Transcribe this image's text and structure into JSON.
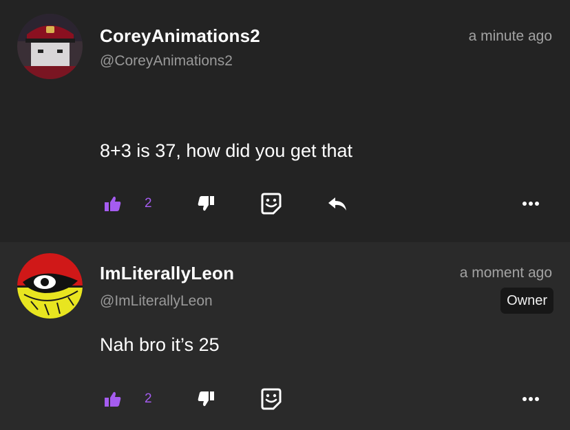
{
  "comments": [
    {
      "display_name": "CoreyAnimations2",
      "handle": "@CoreyAnimations2",
      "timestamp": "a minute ago",
      "body": "8+3 is 37, how did you get that",
      "likes": "2",
      "avatar_icon": "roblox-avatar-red-cap",
      "has_reply": true
    },
    {
      "display_name": "ImLiterallyLeon",
      "handle": "@ImLiterallyLeon",
      "timestamp": "a moment ago",
      "badge": "Owner",
      "body": "Nah bro it’s 25",
      "likes": "2",
      "avatar_icon": "red-black-yellow-eye-logo",
      "has_reply": false
    }
  ],
  "colors": {
    "accent_like": "#a55cf0",
    "background": "#232323",
    "background_alt": "#2a2a2a",
    "muted_text": "#9a9a9a"
  }
}
